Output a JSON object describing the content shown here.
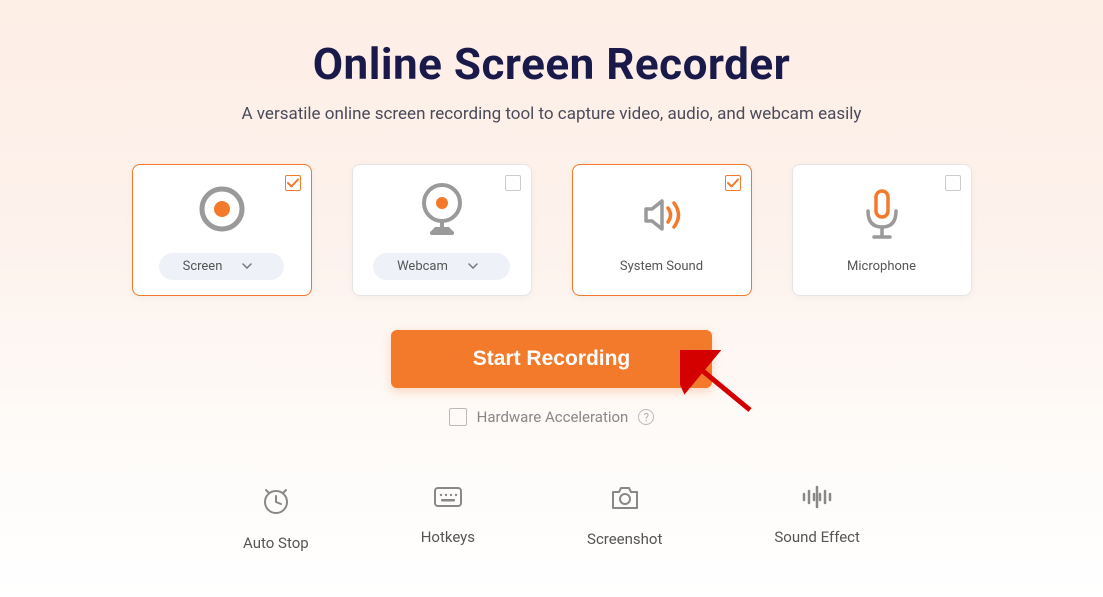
{
  "hero": {
    "title": "Online Screen Recorder",
    "subtitle": "A versatile online screen recording tool to capture video, audio, and webcam easily"
  },
  "cards": [
    {
      "label": "Screen",
      "hasDropdown": true,
      "active": true
    },
    {
      "label": "Webcam",
      "hasDropdown": true,
      "active": false
    },
    {
      "label": "System Sound",
      "hasDropdown": false,
      "active": true
    },
    {
      "label": "Microphone",
      "hasDropdown": false,
      "active": false
    }
  ],
  "actions": {
    "start_label": "Start Recording",
    "hw_accel_label": "Hardware Acceleration"
  },
  "tools": [
    {
      "label": "Auto Stop"
    },
    {
      "label": "Hotkeys"
    },
    {
      "label": "Screenshot"
    },
    {
      "label": "Sound Effect"
    }
  ],
  "colors": {
    "accent": "#f37a2a"
  }
}
